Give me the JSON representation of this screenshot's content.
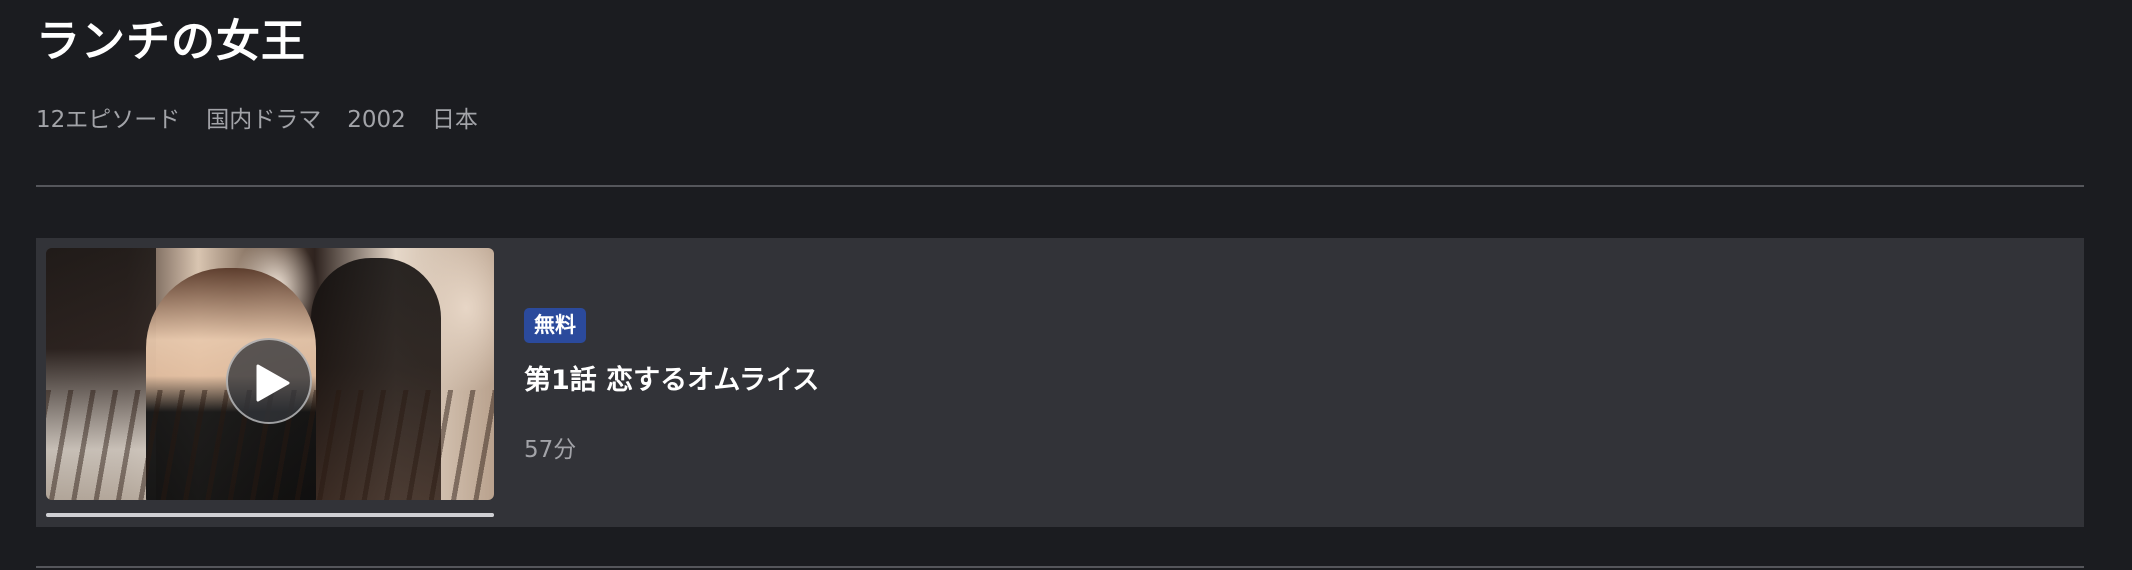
{
  "series": {
    "title": "ランチの女王",
    "meta": [
      "12エピソード",
      "国内ドラマ",
      "2002",
      "日本"
    ]
  },
  "episodes": [
    {
      "badge": "無料",
      "title": "第1話 恋するオムライス",
      "duration": "57分",
      "progress": 1.0,
      "badge_color": "#2b4a9c"
    }
  ],
  "icons": {
    "play": "play-icon"
  },
  "colors": {
    "background": "#1b1c20",
    "card": "#323338",
    "accent": "#2b4a9c",
    "muted_text": "#a2a3a8"
  }
}
